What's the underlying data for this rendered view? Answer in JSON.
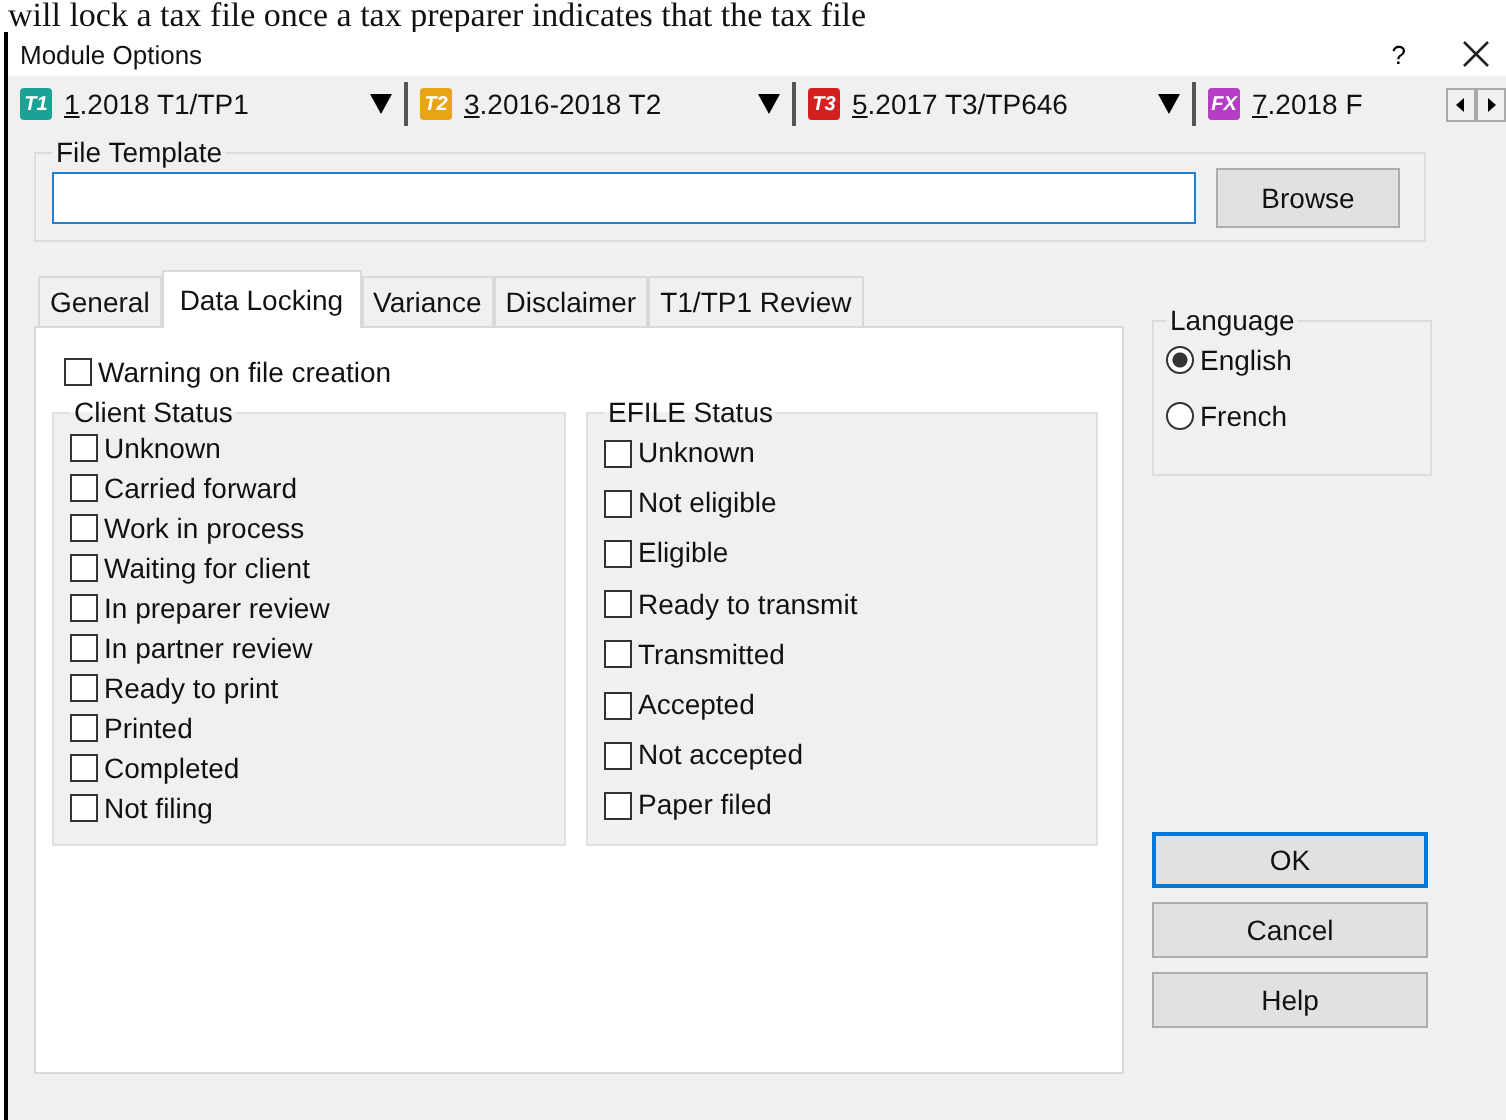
{
  "background_text": "will lock a tax file once a tax preparer indicates that the tax file",
  "window": {
    "title": "Module Options",
    "help": "?"
  },
  "modules": [
    {
      "badge": "T1",
      "color": "#1aa394",
      "mnemonic": "1",
      "label": ".2018 T1/TP1",
      "dropdown": true
    },
    {
      "badge": "T2",
      "color": "#e8a317",
      "mnemonic": "3",
      "label": ".2016-2018 T2",
      "dropdown": true
    },
    {
      "badge": "T3",
      "color": "#d42020",
      "mnemonic": "5",
      "label": ".2017 T3/TP646",
      "dropdown": true
    },
    {
      "badge": "FX",
      "color": "#b53cc4",
      "mnemonic": "7",
      "label": ".2018 F",
      "dropdown": false
    }
  ],
  "file_template": {
    "label": "File Template",
    "button": "Browse"
  },
  "tabs": [
    {
      "label": "General",
      "selected": false
    },
    {
      "label": "Data Locking",
      "selected": true
    },
    {
      "label": "Variance",
      "selected": false
    },
    {
      "label": "Disclaimer",
      "selected": false
    },
    {
      "label": "T1/TP1 Review",
      "selected": false
    }
  ],
  "warning": {
    "label": "Warning on file creation",
    "checked": false
  },
  "groups": [
    {
      "title": "Client Status",
      "items": [
        {
          "label": "Unknown",
          "checked": false
        },
        {
          "label": "Carried forward",
          "checked": false
        },
        {
          "label": "Work in process",
          "checked": false
        },
        {
          "label": "Waiting for client",
          "checked": false
        },
        {
          "label": "In preparer review",
          "checked": false
        },
        {
          "label": "In partner review",
          "checked": false
        },
        {
          "label": "Ready to print",
          "checked": false
        },
        {
          "label": "Printed",
          "checked": false
        },
        {
          "label": "Completed",
          "checked": false
        },
        {
          "label": "Not filing",
          "checked": false
        }
      ]
    },
    {
      "title": "EFILE Status",
      "items": [
        {
          "label": "Unknown",
          "checked": false
        },
        {
          "label": "Not eligible",
          "checked": false
        },
        {
          "label": "Eligible",
          "checked": false
        },
        {
          "label": "Ready to transmit",
          "checked": false
        },
        {
          "label": "Transmitted",
          "checked": false
        },
        {
          "label": "Accepted",
          "checked": false
        },
        {
          "label": "Not accepted",
          "checked": false
        },
        {
          "label": "Paper filed",
          "checked": false
        }
      ]
    }
  ],
  "language": {
    "title": "Language",
    "options": [
      {
        "label": "English",
        "selected": true
      },
      {
        "label": "French",
        "selected": false
      }
    ]
  },
  "buttons": [
    {
      "label": "OK",
      "default": true
    },
    {
      "label": "Cancel",
      "default": false
    },
    {
      "label": "Help",
      "default": false
    }
  ]
}
